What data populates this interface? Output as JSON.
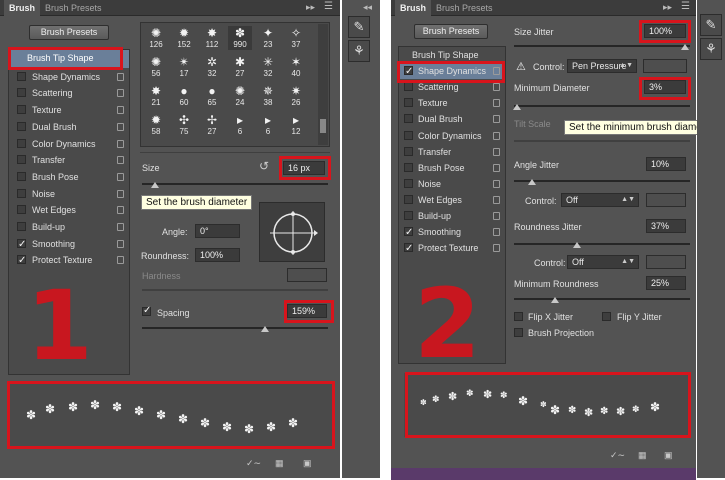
{
  "left": {
    "tabs": [
      "Brush",
      "Brush Presets"
    ],
    "presets_button": "Brush Presets",
    "items": [
      {
        "label": "Brush Tip Shape",
        "check": null
      },
      {
        "label": "Shape Dynamics",
        "check": false
      },
      {
        "label": "Scattering",
        "check": false
      },
      {
        "label": "Texture",
        "check": false
      },
      {
        "label": "Dual Brush",
        "check": false
      },
      {
        "label": "Color Dynamics",
        "check": false
      },
      {
        "label": "Transfer",
        "check": false
      },
      {
        "label": "Brush Pose",
        "check": false
      },
      {
        "label": "Noise",
        "check": false
      },
      {
        "label": "Wet Edges",
        "check": false
      },
      {
        "label": "Build-up",
        "check": false
      },
      {
        "label": "Smoothing",
        "check": true
      },
      {
        "label": "Protect Texture",
        "check": true
      }
    ],
    "tip_sizes": [
      "126",
      "152",
      "112",
      "990",
      "23",
      "37",
      "56",
      "17",
      "32",
      "27",
      "32",
      "40",
      "21",
      "60",
      "65",
      "24",
      "38",
      "26",
      "58",
      "75",
      "27",
      "6",
      "6",
      "12"
    ],
    "size_label": "Size",
    "size_value": "16 px",
    "size_tooltip": "Set the brush diameter",
    "angle_label": "Angle:",
    "angle_value": "0°",
    "roundness_label": "Roundness:",
    "roundness_value": "100%",
    "hardness_label": "Hardness",
    "spacing_label": "Spacing",
    "spacing_value": "159%",
    "big_number": "1"
  },
  "right": {
    "tabs": [
      "Brush",
      "Brush Presets"
    ],
    "presets_button": "Brush Presets",
    "items": [
      {
        "label": "Brush Tip Shape",
        "check": null
      },
      {
        "label": "Shape Dynamics",
        "check": true
      },
      {
        "label": "Scattering",
        "check": false
      },
      {
        "label": "Texture",
        "check": false
      },
      {
        "label": "Dual Brush",
        "check": false
      },
      {
        "label": "Color Dynamics",
        "check": false
      },
      {
        "label": "Transfer",
        "check": false
      },
      {
        "label": "Brush Pose",
        "check": false
      },
      {
        "label": "Noise",
        "check": false
      },
      {
        "label": "Wet Edges",
        "check": false
      },
      {
        "label": "Build-up",
        "check": false
      },
      {
        "label": "Smoothing",
        "check": true
      },
      {
        "label": "Protect Texture",
        "check": true
      }
    ],
    "size_jitter_label": "Size Jitter",
    "size_jitter_value": "100%",
    "control_label": "Control:",
    "control_value": "Pen Pressure",
    "min_diameter_label": "Minimum Diameter",
    "min_diameter_value": "3%",
    "min_diameter_tooltip": "Set the minimum brush diameter",
    "tilt_scale_label": "Tilt Scale",
    "angle_jitter_label": "Angle Jitter",
    "angle_jitter_value": "10%",
    "angle_control_value": "Off",
    "roundness_jitter_label": "Roundness Jitter",
    "roundness_jitter_value": "37%",
    "roundness_control_value": "Off",
    "min_roundness_label": "Minimum Roundness",
    "min_roundness_value": "25%",
    "flip_x_label": "Flip X Jitter",
    "flip_y_label": "Flip Y Jitter",
    "projection_label": "Brush Projection",
    "big_number": "2"
  }
}
